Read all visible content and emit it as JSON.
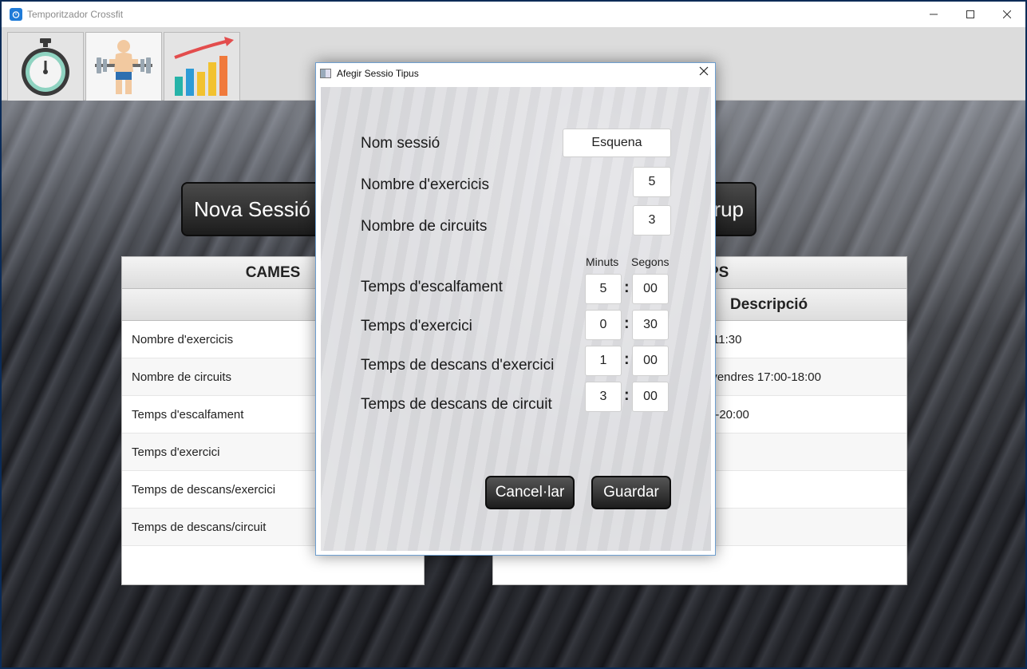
{
  "window": {
    "title": "Temporitzador Crossfit",
    "controls": [
      "minimize",
      "maximize",
      "close"
    ]
  },
  "toolbar": {
    "tabs": [
      {
        "icon": "stopwatch-icon"
      },
      {
        "icon": "weightlifter-icon"
      },
      {
        "icon": "growth-chart-icon"
      }
    ]
  },
  "main": {
    "new_session_button": "Nova Sessió T",
    "group_button": "rup",
    "left_table": {
      "caption": "CAMES",
      "rows": [
        "Nombre d'exercicis",
        "Nombre de circuits",
        "Temps d'escalfament",
        "Temps d'exercici",
        "Temps de descans/exercici",
        "Temps de descans/circuit"
      ]
    },
    "right_table": {
      "caption": "PS",
      "header": "Descripció",
      "rows": [
        "-11:30",
        "ivendres 17:00-18:00",
        "0-20:00",
        "",
        "",
        ""
      ]
    }
  },
  "dialog": {
    "title": "Afegir Sessio Tipus",
    "fields": {
      "nom_label": "Nom sessió",
      "nom_value": "Esquena",
      "exercicis_label": "Nombre d'exercicis",
      "exercicis_value": "5",
      "circuits_label": "Nombre de circuits",
      "circuits_value": "3"
    },
    "time_headers": {
      "minutes": "Minuts",
      "seconds": "Segons"
    },
    "times": [
      {
        "label": "Temps d'escalfament",
        "min": "5",
        "sec": "00"
      },
      {
        "label": "Temps d'exercici",
        "min": "0",
        "sec": "30"
      },
      {
        "label": "Temps de descans d'exercici",
        "min": "1",
        "sec": "00"
      },
      {
        "label": "Temps de descans de circuit",
        "min": "3",
        "sec": "00"
      }
    ],
    "separator": ":",
    "cancel_label": "Cancel·lar",
    "save_label": "Guardar"
  }
}
